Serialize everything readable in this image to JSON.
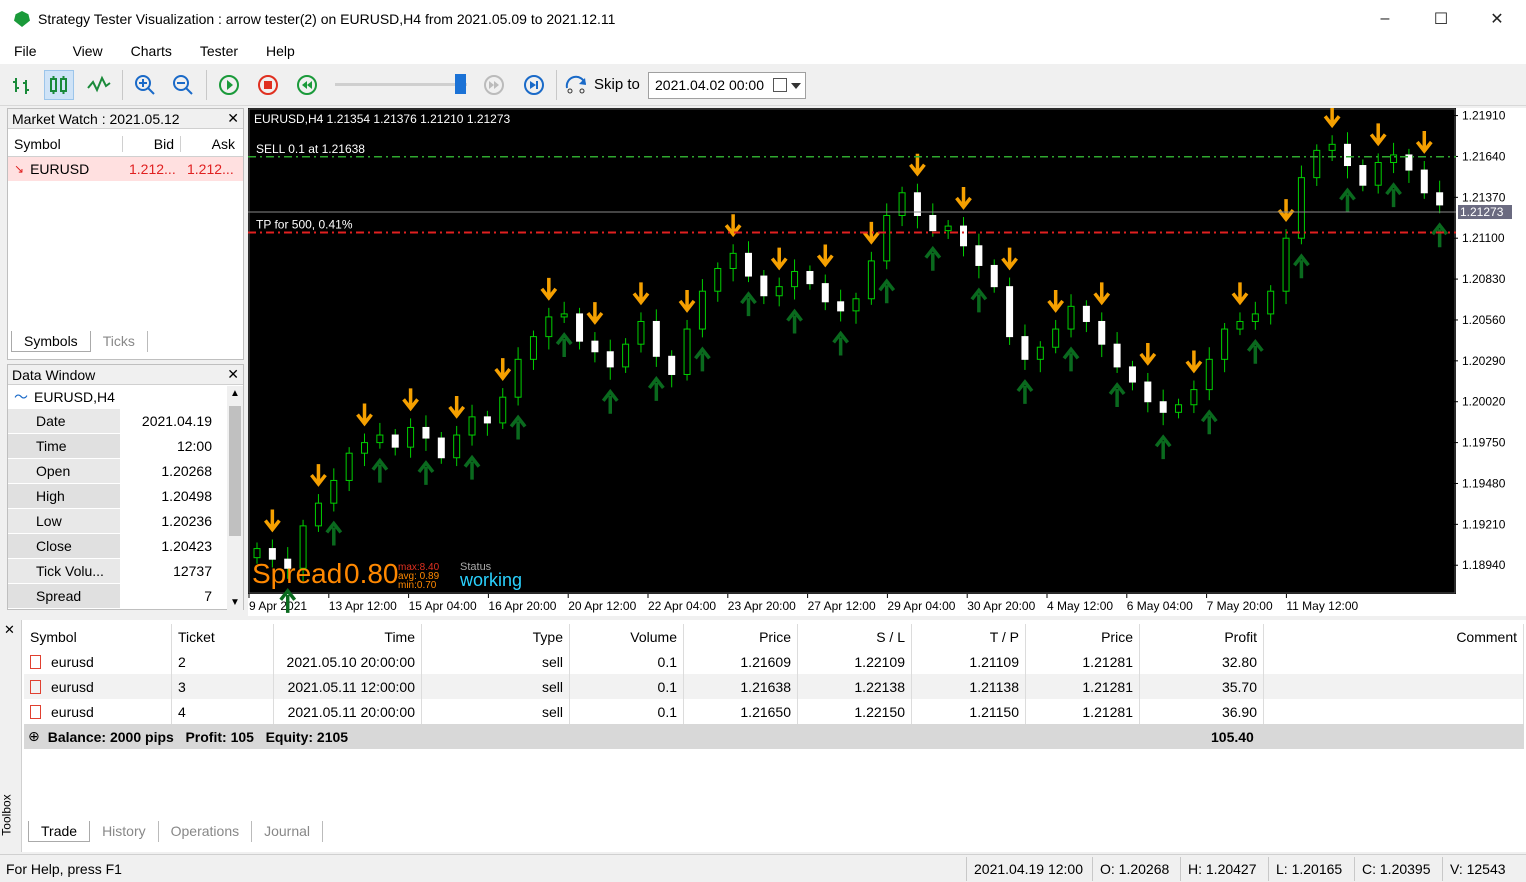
{
  "window": {
    "title": "Strategy Tester Visualization : arrow tester(2) on EURUSD,H4 from 2021.05.09 to 2021.12.11",
    "controls": [
      "–",
      "☐",
      "✕"
    ]
  },
  "menu": [
    "File",
    "View",
    "Charts",
    "Tester",
    "Help"
  ],
  "toolbar": {
    "icons": [
      "bar-chart-icon",
      "candle-chart-icon",
      "line-chart-icon",
      "zoom-in-icon",
      "zoom-out-icon",
      "play-icon",
      "stop-icon",
      "rewind-icon",
      "fast-forward-icon",
      "skip-to-end-icon",
      "skip-to-icon"
    ],
    "skip_label": "Skip to",
    "skip_value": "2021.04.02 00:00",
    "speed_fraction": 0.95
  },
  "market_watch": {
    "title": "Market Watch : 2021.05.12",
    "columns": [
      "Symbol",
      "Bid",
      "Ask"
    ],
    "rows": [
      {
        "symbol": "EURUSD",
        "bid": "1.212...",
        "ask": "1.212..."
      }
    ],
    "tabs": [
      "Symbols",
      "Ticks"
    ]
  },
  "data_window": {
    "title": "Data Window",
    "symbol": "EURUSD,H4",
    "rows": [
      {
        "k": "Date",
        "v": "2021.04.19"
      },
      {
        "k": "Time",
        "v": "12:00"
      },
      {
        "k": "Open",
        "v": "1.20268"
      },
      {
        "k": "High",
        "v": "1.20498"
      },
      {
        "k": "Low",
        "v": "1.20236"
      },
      {
        "k": "Close",
        "v": "1.20423"
      },
      {
        "k": "Tick Volu...",
        "v": "12737"
      },
      {
        "k": "Spread",
        "v": "7"
      }
    ]
  },
  "chart": {
    "header": "EURUSD,H4  1.21354 1.21376 1.21210 1.21273",
    "sell_label": "SELL 0.1 at 1.21638",
    "tp_label": "TP for 500, 0.41%",
    "current_price": "1.21273",
    "price_min": 1.1875,
    "price_max": 1.2196,
    "y_ticks": [
      "1.21910",
      "1.21640",
      "1.21370",
      "1.21100",
      "1.20830",
      "1.20560",
      "1.20290",
      "1.20020",
      "1.19750",
      "1.19480",
      "1.19210",
      "1.18940"
    ],
    "x_ticks": [
      "9 Apr 2021",
      "13 Apr 12:00",
      "15 Apr 04:00",
      "16 Apr 20:00",
      "20 Apr 12:00",
      "22 Apr 04:00",
      "23 Apr 20:00",
      "27 Apr 12:00",
      "29 Apr 04:00",
      "30 Apr 20:00",
      "4 May 12:00",
      "6 May 04:00",
      "7 May 20:00",
      "11 May 12:00"
    ],
    "spread_label": "Spread",
    "spread_value": "0.80",
    "spread_max": "max:8.40",
    "spread_avg": "avg: 0.89",
    "spread_min": "min:0.70",
    "status_label": "Status",
    "status_value": "working",
    "colors": {
      "bull": "#ffffff",
      "bear": "#ffffff",
      "wick": "#00d000",
      "sell_arrow": "#f5a000",
      "buy_arrow": "#0a6a1e",
      "sell_line": "#2fa82f",
      "tp_line": "#e02020"
    }
  },
  "trades": {
    "columns": [
      "Symbol",
      "Ticket",
      "Time",
      "Type",
      "Volume",
      "Price",
      "S / L",
      "T / P",
      "Price",
      "Profit",
      "Comment"
    ],
    "rows": [
      {
        "symbol": "eurusd",
        "ticket": "2",
        "time": "2021.05.10 20:00:00",
        "type": "sell",
        "volume": "0.1",
        "price": "1.21609",
        "sl": "1.22109",
        "tp": "1.21109",
        "cur": "1.21281",
        "profit": "32.80"
      },
      {
        "symbol": "eurusd",
        "ticket": "3",
        "time": "2021.05.11 12:00:00",
        "type": "sell",
        "volume": "0.1",
        "price": "1.21638",
        "sl": "1.22138",
        "tp": "1.21138",
        "cur": "1.21281",
        "profit": "35.70"
      },
      {
        "symbol": "eurusd",
        "ticket": "4",
        "time": "2021.05.11 20:00:00",
        "type": "sell",
        "volume": "0.1",
        "price": "1.21650",
        "sl": "1.22150",
        "tp": "1.21150",
        "cur": "1.21281",
        "profit": "36.90"
      }
    ],
    "summary": "Balance: 2000 pips   Profit: 105   Equity: 2105",
    "summary_total": "105.40",
    "tabs": [
      "Trade",
      "History",
      "Operations",
      "Journal"
    ],
    "side_label": "Toolbox"
  },
  "status": {
    "help": "For Help, press F1",
    "datetime": "2021.04.19 12:00",
    "open": "O: 1.20268",
    "high": "H: 1.20427",
    "low": "L: 1.20165",
    "close": "C: 1.20395",
    "volume": "V: 12543"
  }
}
